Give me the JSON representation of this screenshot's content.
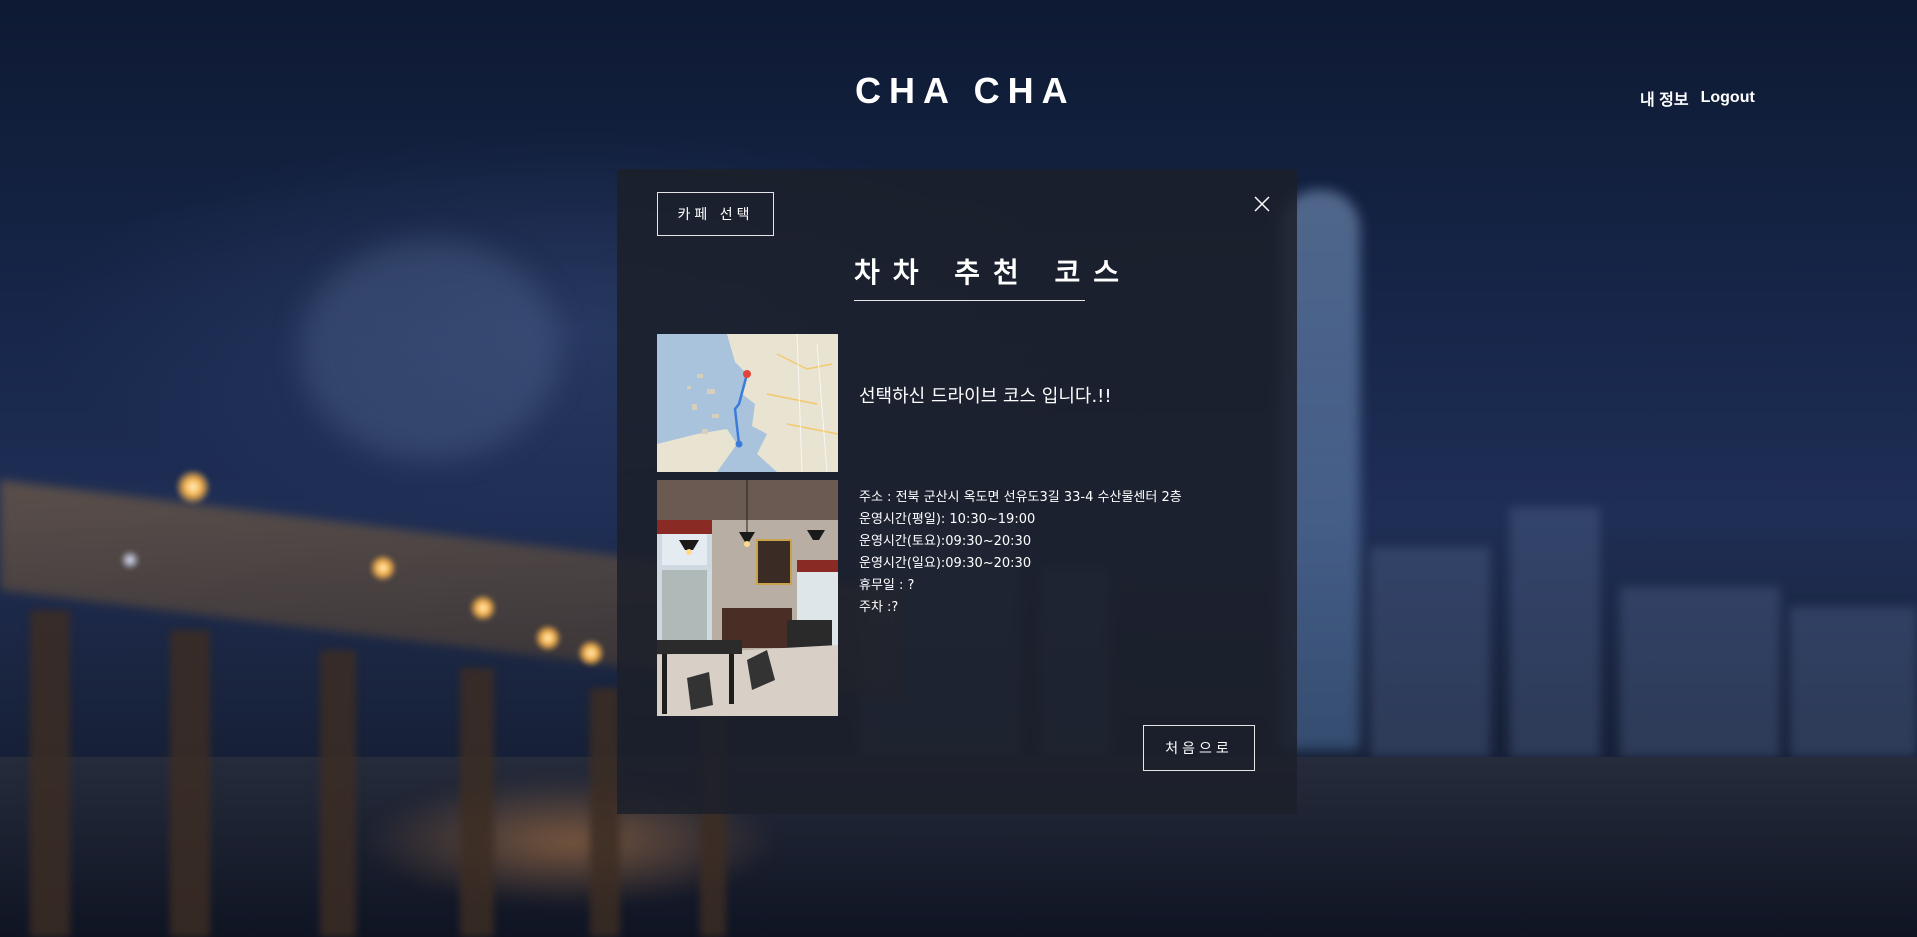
{
  "header": {
    "logo": "CHA CHA",
    "nav": {
      "my_info": "내 정보",
      "logout": "Logout"
    }
  },
  "panel": {
    "cafe_select_label": "카페 선택",
    "title": "차차 추천 코스",
    "course_message": "선택하신 드라이브 코스 입니다.!!",
    "info": {
      "address": "주소 : 전북 군산시 옥도면 선유도3길 33-4 수산물센터 2층",
      "hours_weekday": "운영시간(평일): 10:30~19:00",
      "hours_saturday": "운영시간(토요):09:30~20:30",
      "hours_sunday": "운영시간(일요):09:30~20:30",
      "closed": "휴무일 : ?",
      "parking": "주차 :?"
    },
    "home_label": "처음으로"
  },
  "icons": {
    "close": "close-icon"
  },
  "colors": {
    "panel_bg": "#1c202a",
    "text": "#ffffff",
    "border": "#e6e6e6"
  }
}
